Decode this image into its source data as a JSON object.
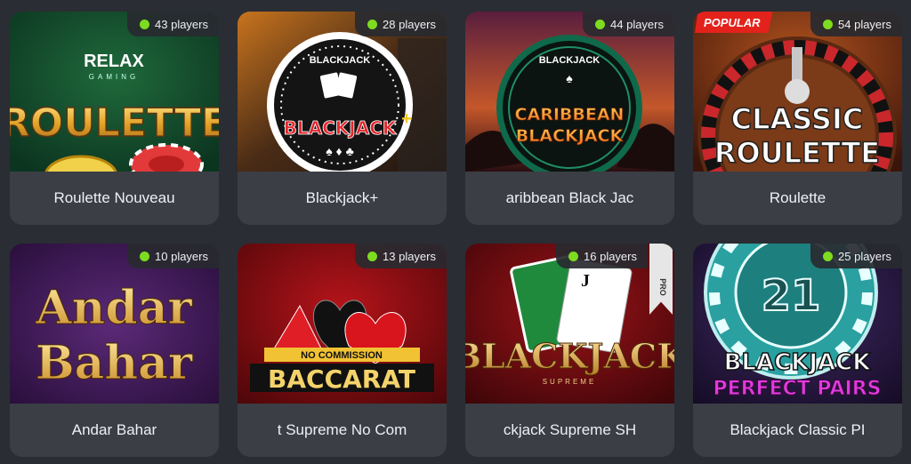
{
  "games": [
    {
      "title": "Roulette Nouveau",
      "players": "43 players",
      "art": "roulette-nouveau",
      "provider": "RELAX",
      "provider_sub": "GAMING",
      "art_text": "ROULETTE"
    },
    {
      "title": "Blackjack+",
      "players": "28 players",
      "art": "blackjack-plus",
      "art_text": "BLACKJACK",
      "art_badge": "BLACKJACK"
    },
    {
      "title": "aribbean Black Jac",
      "players": "44 players",
      "art": "caribbean",
      "art_text": "CARIBBEAN",
      "art_text2": "BLACKJACK",
      "art_badge": "BLACKJACK"
    },
    {
      "title": "Roulette",
      "players": "54 players",
      "art": "classic-roulette",
      "badge": "POPULAR",
      "art_text": "CLASSIC",
      "art_text2": "ROULETTE"
    },
    {
      "title": "Andar Bahar",
      "players": "10 players",
      "art": "andar-bahar",
      "art_text": "Andar",
      "art_text2": "Bahar"
    },
    {
      "title": "t Supreme No Com",
      "players": "13 players",
      "art": "baccarat",
      "art_text": "NO COMMISSION",
      "art_text2": "BACCARAT"
    },
    {
      "title": "ckjack Supreme SH",
      "players": "16 players",
      "art": "blackjack-supreme",
      "tag": "PRO",
      "art_text": "BLACKJACK",
      "art_text2": "SUPREME"
    },
    {
      "title": "Blackjack Classic PI",
      "players": "25 players",
      "art": "perfect-pairs",
      "art_text": "BLACKJACK",
      "art_text2": "PERFECT PAIRS",
      "art_badge": "21"
    }
  ],
  "colors": {
    "online_dot": "#7ddc1f",
    "card_bg": "#3b3e45",
    "page_bg": "#2a2d33",
    "popular": "#e3221c"
  }
}
